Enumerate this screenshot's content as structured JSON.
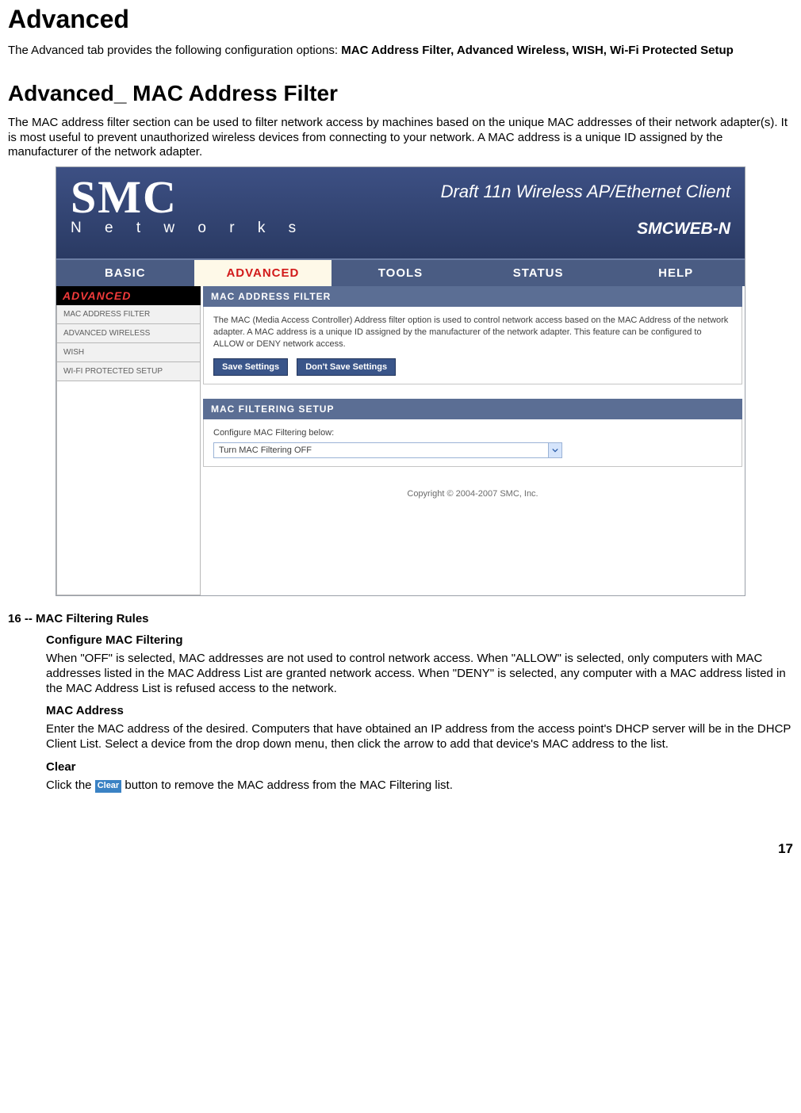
{
  "page": {
    "h1": "Advanced",
    "intro_pre": "The Advanced tab provides the following configuration options: ",
    "intro_bold": "MAC Address Filter, Advanced Wireless, WISH, Wi-Fi Protected Setup",
    "h2": "Advanced_ MAC Address Filter",
    "desc": "The MAC address filter section can be used to filter network access by machines based on the unique MAC addresses of their network adapter(s). It is most useful to prevent unauthorized wireless devices from connecting to your network. A MAC address is a unique ID assigned by the manufacturer of the network adapter.",
    "page_number": "17"
  },
  "screenshot": {
    "logo_main": "SMC",
    "logo_sub_letters": "N e t w o r k s",
    "header_title": "Draft 11n Wireless AP/Ethernet Client",
    "model": "SMCWEB-N",
    "nav": {
      "basic": "BASIC",
      "advanced": "ADVANCED",
      "tools": "TOOLS",
      "status": "STATUS",
      "help": "HELP"
    },
    "sidebar": {
      "header": "ADVANCED",
      "items": [
        "MAC ADDRESS FILTER",
        "ADVANCED WIRELESS",
        "WISH",
        "WI-FI PROTECTED SETUP"
      ]
    },
    "panel_filter": {
      "title": "MAC ADDRESS FILTER",
      "body": "The MAC (Media Access Controller) Address filter option is used to control network access based on the MAC Address of the network adapter. A MAC address is a unique ID assigned by the manufacturer of the network adapter. This feature can be configured to ALLOW or DENY network access.",
      "save": "Save Settings",
      "dont_save": "Don't Save Settings"
    },
    "panel_setup": {
      "title": "MAC FILTERING SETUP",
      "label": "Configure MAC Filtering below:",
      "dropdown_value": "Turn MAC Filtering OFF"
    },
    "copyright": "Copyright © 2004-2007 SMC, Inc."
  },
  "rules": {
    "heading": "16 -- MAC Filtering Rules",
    "s1_h": "Configure MAC Filtering",
    "s1_p": "When \"OFF\" is selected, MAC addresses are not used to control network access. When \"ALLOW\" is selected, only computers with MAC addresses listed in the MAC Address List are granted network access. When \"DENY\" is selected, any computer with a MAC address listed in the MAC Address List is refused access to the network.",
    "s2_h": "MAC Address",
    "s2_p": "Enter the MAC address of the desired. Computers that have obtained an IP address from the access point's DHCP server will be in the DHCP Client List. Select a device from the drop down menu, then click the arrow to add that device's MAC address to the list.",
    "s3_h": "Clear",
    "s3_pre": "Click the ",
    "s3_btn": "Clear",
    "s3_post": " button to remove the MAC address from the MAC Filtering list."
  }
}
